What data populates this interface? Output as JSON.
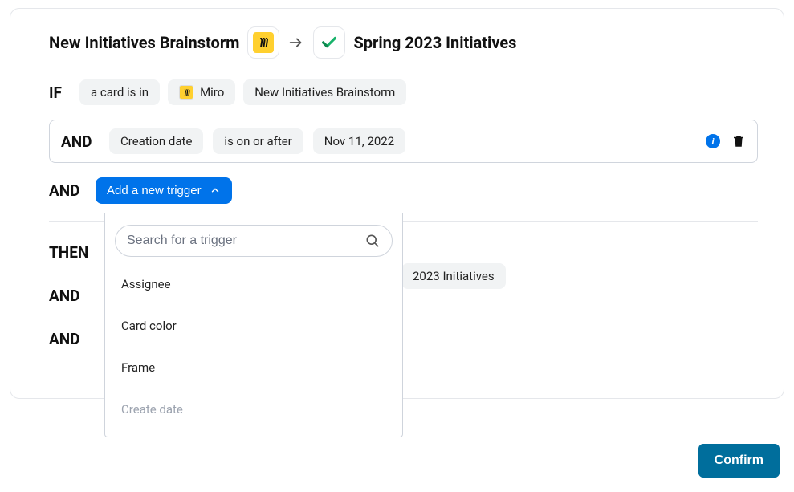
{
  "header": {
    "source_title": "New Initiatives Brainstorm",
    "dest_title": "Spring 2023 Initiatives"
  },
  "rows": {
    "if": {
      "keyword": "IF",
      "pill1": "a card is in",
      "pill2": "Miro",
      "pill3": "New Initiatives Brainstorm"
    },
    "and1": {
      "keyword": "AND",
      "pill1": "Creation date",
      "pill2": "is on or after",
      "pill3": "Nov 11, 2022"
    },
    "and2": {
      "keyword": "AND",
      "button": "Add a new trigger"
    },
    "then": {
      "keyword": "THEN",
      "peek_pill": "2023 Initiatives"
    },
    "and3": {
      "keyword": "AND"
    },
    "and4": {
      "keyword": "AND"
    }
  },
  "dropdown": {
    "search_placeholder": "Search for a trigger",
    "items": {
      "0": "Assignee",
      "1": "Card color",
      "2": "Frame",
      "3": "Create date"
    }
  },
  "footer": {
    "confirm": "Confirm"
  }
}
